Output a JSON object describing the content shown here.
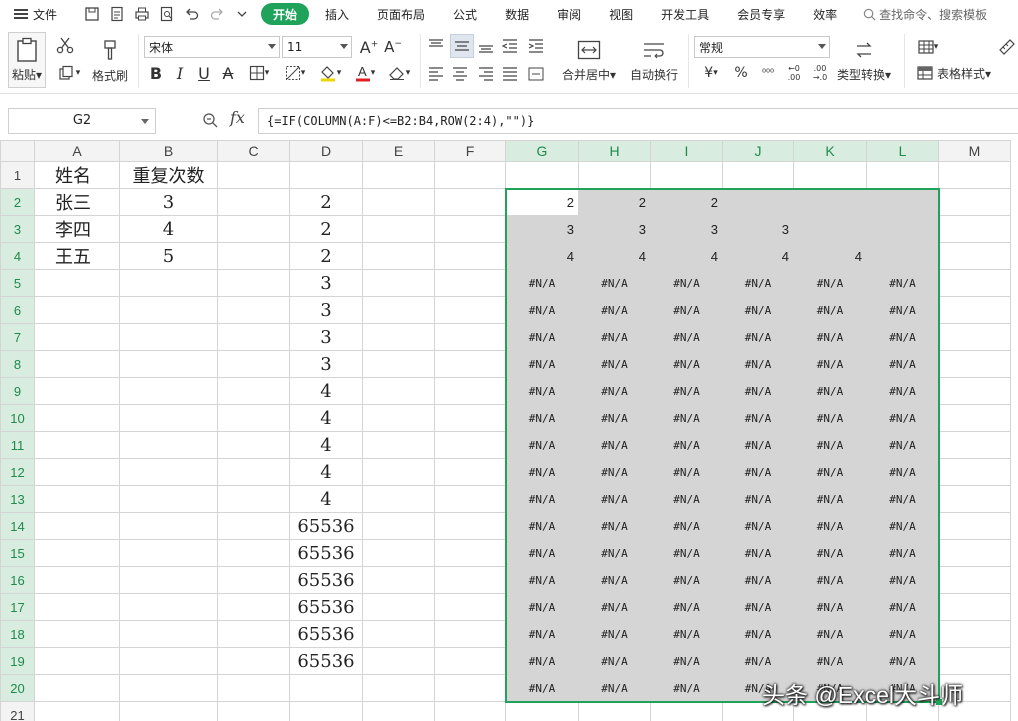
{
  "menubar": {
    "file_label": "文件",
    "tabs": [
      {
        "label": "开始",
        "active": true
      },
      {
        "label": "插入"
      },
      {
        "label": "页面布局"
      },
      {
        "label": "公式"
      },
      {
        "label": "数据"
      },
      {
        "label": "审阅"
      },
      {
        "label": "视图"
      },
      {
        "label": "开发工具"
      },
      {
        "label": "会员专享"
      },
      {
        "label": "效率"
      }
    ],
    "search_placeholder": "查找命令、搜索模板"
  },
  "ribbon": {
    "paste_label": "粘贴",
    "format_painter_label": "格式刷",
    "font_name": "宋体",
    "font_size": "11",
    "merge_center_label": "合并居中",
    "wrap_text_label": "自动换行",
    "number_format": "常规",
    "currency_symbol": "¥",
    "percent_symbol": "%",
    "type_convert_label": "类型转换",
    "table_style_label": "表格样式"
  },
  "formula_bar": {
    "name_box": "G2",
    "fx_label": "fx",
    "formula": "{=IF(COLUMN(A:F)<=B2:B4,ROW(2:4),\"\")}"
  },
  "columns": [
    "A",
    "B",
    "C",
    "D",
    "E",
    "F",
    "G",
    "H",
    "I",
    "J",
    "K",
    "L",
    "M"
  ],
  "rows": {
    "1": {
      "A": "姓名",
      "B": "重复次数"
    },
    "2": {
      "A": "张三",
      "B": "3",
      "D": "2",
      "G": "2",
      "H": "2",
      "I": "2",
      "J": "",
      "K": "",
      "L": ""
    },
    "3": {
      "A": "李四",
      "B": "4",
      "D": "2",
      "G": "3",
      "H": "3",
      "I": "3",
      "J": "3",
      "K": "",
      "L": ""
    },
    "4": {
      "A": "王五",
      "B": "5",
      "D": "2",
      "G": "4",
      "H": "4",
      "I": "4",
      "J": "4",
      "K": "4",
      "L": ""
    },
    "5": {
      "D": "3",
      "G": "#N/A",
      "H": "#N/A",
      "I": "#N/A",
      "J": "#N/A",
      "K": "#N/A",
      "L": "#N/A"
    },
    "6": {
      "D": "3",
      "G": "#N/A",
      "H": "#N/A",
      "I": "#N/A",
      "J": "#N/A",
      "K": "#N/A",
      "L": "#N/A"
    },
    "7": {
      "D": "3",
      "G": "#N/A",
      "H": "#N/A",
      "I": "#N/A",
      "J": "#N/A",
      "K": "#N/A",
      "L": "#N/A"
    },
    "8": {
      "D": "3",
      "G": "#N/A",
      "H": "#N/A",
      "I": "#N/A",
      "J": "#N/A",
      "K": "#N/A",
      "L": "#N/A"
    },
    "9": {
      "D": "4",
      "G": "#N/A",
      "H": "#N/A",
      "I": "#N/A",
      "J": "#N/A",
      "K": "#N/A",
      "L": "#N/A"
    },
    "10": {
      "D": "4",
      "G": "#N/A",
      "H": "#N/A",
      "I": "#N/A",
      "J": "#N/A",
      "K": "#N/A",
      "L": "#N/A"
    },
    "11": {
      "D": "4",
      "G": "#N/A",
      "H": "#N/A",
      "I": "#N/A",
      "J": "#N/A",
      "K": "#N/A",
      "L": "#N/A"
    },
    "12": {
      "D": "4",
      "G": "#N/A",
      "H": "#N/A",
      "I": "#N/A",
      "J": "#N/A",
      "K": "#N/A",
      "L": "#N/A"
    },
    "13": {
      "D": "4",
      "G": "#N/A",
      "H": "#N/A",
      "I": "#N/A",
      "J": "#N/A",
      "K": "#N/A",
      "L": "#N/A"
    },
    "14": {
      "D": "65536",
      "G": "#N/A",
      "H": "#N/A",
      "I": "#N/A",
      "J": "#N/A",
      "K": "#N/A",
      "L": "#N/A"
    },
    "15": {
      "D": "65536",
      "G": "#N/A",
      "H": "#N/A",
      "I": "#N/A",
      "J": "#N/A",
      "K": "#N/A",
      "L": "#N/A"
    },
    "16": {
      "D": "65536",
      "G": "#N/A",
      "H": "#N/A",
      "I": "#N/A",
      "J": "#N/A",
      "K": "#N/A",
      "L": "#N/A"
    },
    "17": {
      "D": "65536",
      "G": "#N/A",
      "H": "#N/A",
      "I": "#N/A",
      "J": "#N/A",
      "K": "#N/A",
      "L": "#N/A"
    },
    "18": {
      "D": "65536",
      "G": "#N/A",
      "H": "#N/A",
      "I": "#N/A",
      "J": "#N/A",
      "K": "#N/A",
      "L": "#N/A"
    },
    "19": {
      "D": "65536",
      "G": "#N/A",
      "H": "#N/A",
      "I": "#N/A",
      "J": "#N/A",
      "K": "#N/A",
      "L": "#N/A"
    },
    "20": {
      "G": "#N/A",
      "H": "#N/A",
      "I": "#N/A",
      "J": "#N/A",
      "K": "#N/A",
      "L": "#N/A"
    },
    "21": {}
  },
  "selection": {
    "range": "G2:L20",
    "active_cell": "G2"
  },
  "watermark": "头条 @Excel大斗师",
  "colors": {
    "accent": "#1fa35a",
    "selection_fill": "#d5d5d5",
    "header_highlight": "#d8ecdf"
  }
}
